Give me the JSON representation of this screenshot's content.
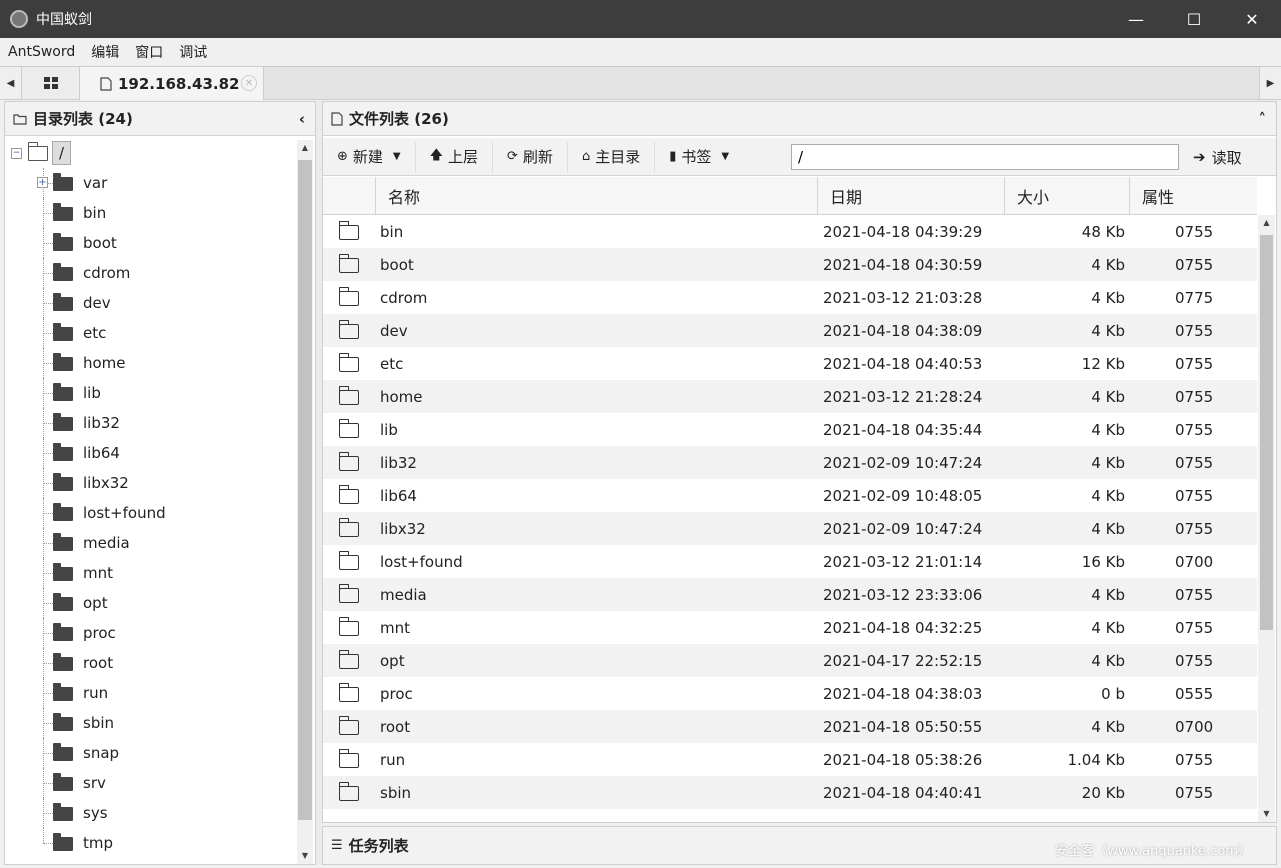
{
  "window": {
    "title": "中国蚁剑",
    "minimize": "—",
    "maximize": "☐",
    "close": "✕"
  },
  "menu": [
    "AntSword",
    "编辑",
    "窗口",
    "调试"
  ],
  "tabs": {
    "active_label": "192.168.43.82",
    "left_arrow": "◀",
    "right_arrow": "▶"
  },
  "left_panel": {
    "title": "目录列表 (24)",
    "collapse": "‹",
    "root": "/",
    "items": [
      "var",
      "bin",
      "boot",
      "cdrom",
      "dev",
      "etc",
      "home",
      "lib",
      "lib32",
      "lib64",
      "libx32",
      "lost+found",
      "media",
      "mnt",
      "opt",
      "proc",
      "root",
      "run",
      "sbin",
      "snap",
      "srv",
      "sys",
      "tmp"
    ]
  },
  "right_panel": {
    "title": "文件列表 (26)",
    "collapse": "˄",
    "toolbar": {
      "new_label": "新建",
      "up_label": "上层",
      "refresh_label": "刷新",
      "home_label": "主目录",
      "bookmark_label": "书签",
      "path_value": "/",
      "read_label": "读取"
    },
    "columns": [
      "名称",
      "日期",
      "大小",
      "属性"
    ],
    "rows": [
      {
        "name": "bin",
        "date": "2021-04-18 04:39:29",
        "size": "48 Kb",
        "perm": "0755"
      },
      {
        "name": "boot",
        "date": "2021-04-18 04:30:59",
        "size": "4 Kb",
        "perm": "0755"
      },
      {
        "name": "cdrom",
        "date": "2021-03-12 21:03:28",
        "size": "4 Kb",
        "perm": "0775"
      },
      {
        "name": "dev",
        "date": "2021-04-18 04:38:09",
        "size": "4 Kb",
        "perm": "0755"
      },
      {
        "name": "etc",
        "date": "2021-04-18 04:40:53",
        "size": "12 Kb",
        "perm": "0755"
      },
      {
        "name": "home",
        "date": "2021-03-12 21:28:24",
        "size": "4 Kb",
        "perm": "0755"
      },
      {
        "name": "lib",
        "date": "2021-04-18 04:35:44",
        "size": "4 Kb",
        "perm": "0755"
      },
      {
        "name": "lib32",
        "date": "2021-02-09 10:47:24",
        "size": "4 Kb",
        "perm": "0755"
      },
      {
        "name": "lib64",
        "date": "2021-02-09 10:48:05",
        "size": "4 Kb",
        "perm": "0755"
      },
      {
        "name": "libx32",
        "date": "2021-02-09 10:47:24",
        "size": "4 Kb",
        "perm": "0755"
      },
      {
        "name": "lost+found",
        "date": "2021-03-12 21:01:14",
        "size": "16 Kb",
        "perm": "0700"
      },
      {
        "name": "media",
        "date": "2021-03-12 23:33:06",
        "size": "4 Kb",
        "perm": "0755"
      },
      {
        "name": "mnt",
        "date": "2021-04-18 04:32:25",
        "size": "4 Kb",
        "perm": "0755"
      },
      {
        "name": "opt",
        "date": "2021-04-17 22:52:15",
        "size": "4 Kb",
        "perm": "0755"
      },
      {
        "name": "proc",
        "date": "2021-04-18 04:38:03",
        "size": "0 b",
        "perm": "0555"
      },
      {
        "name": "root",
        "date": "2021-04-18 05:50:55",
        "size": "4 Kb",
        "perm": "0700"
      },
      {
        "name": "run",
        "date": "2021-04-18 05:38:26",
        "size": "1.04 Kb",
        "perm": "0755"
      },
      {
        "name": "sbin",
        "date": "2021-04-18 04:40:41",
        "size": "20 Kb",
        "perm": "0755"
      }
    ]
  },
  "task_panel": {
    "title": "任务列表",
    "collapse": "˄"
  },
  "watermark": "安全客（www.anquanke.com）"
}
